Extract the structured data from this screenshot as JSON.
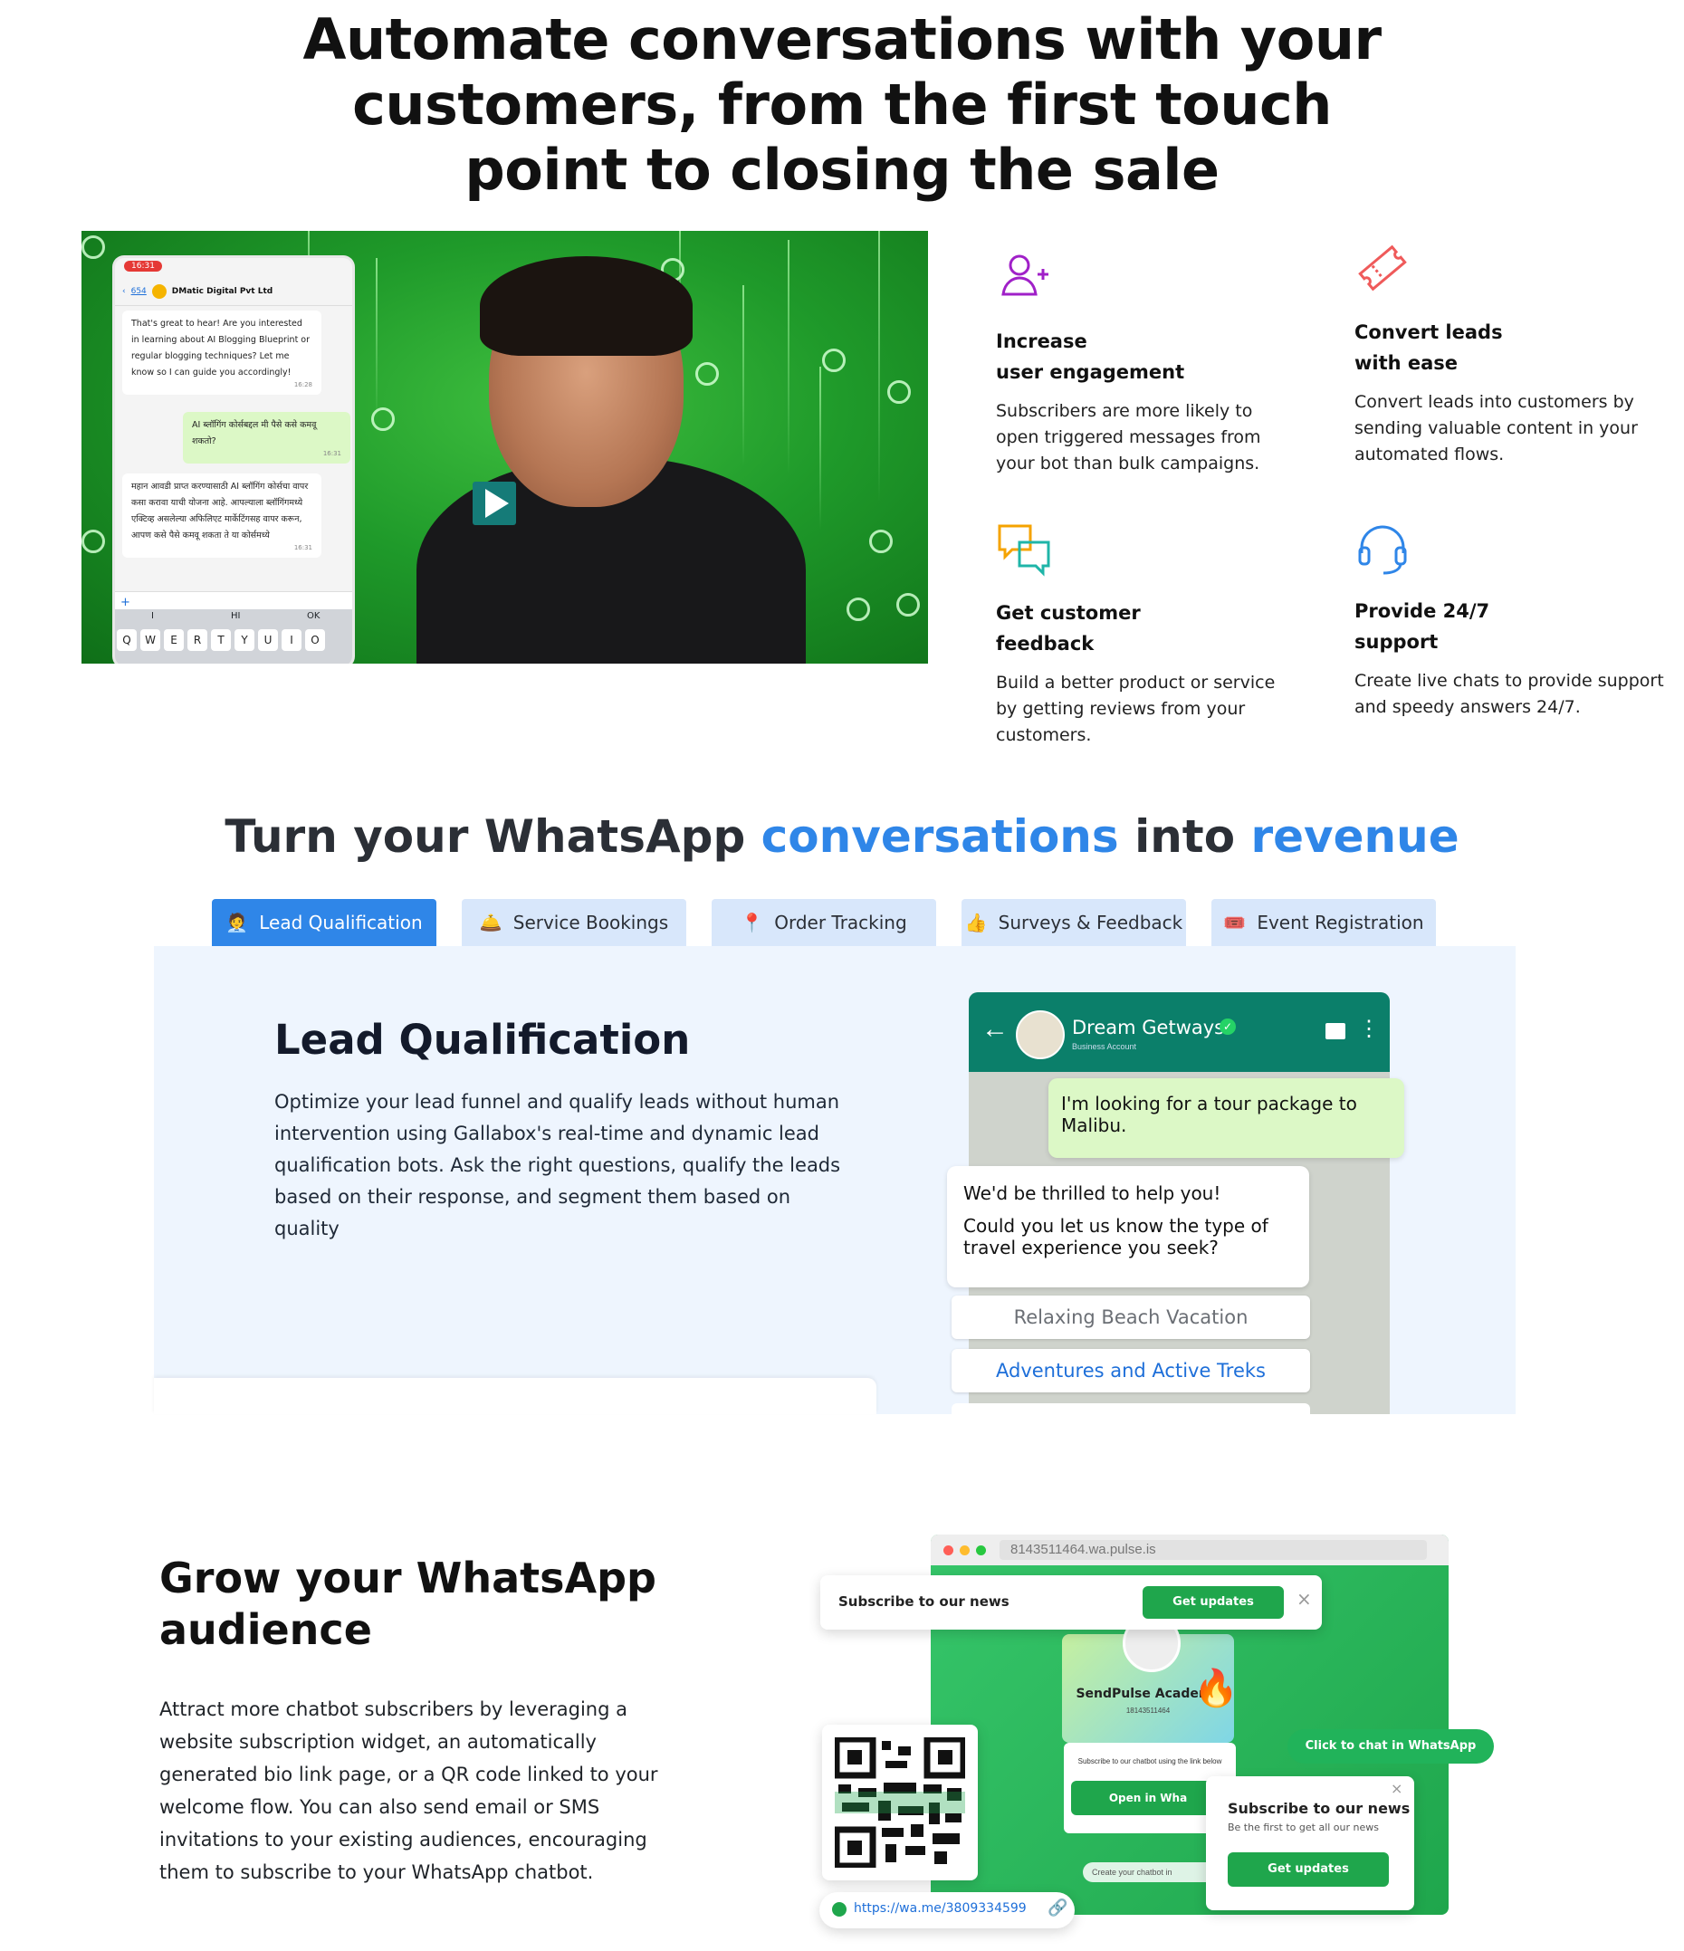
{
  "hero": {
    "title": "Automate conversations with your customers, from the first touch point to closing the sale"
  },
  "video": {
    "phone_time": "16:31",
    "phone_back": "654",
    "phone_contact": "DMatic Digital Pvt Ltd",
    "msg1": "That's great to hear! Are you interested in learning about AI Blogging Blueprint or regular blogging techniques? Let me know so I can guide you accordingly!",
    "msg1_time": "16:28",
    "msg2": "AI ब्लॉगिंग कोर्सबद्दल मी पैसे कसे कमवू शकतो?",
    "msg2_time": "16:31",
    "msg3": "महान आवडी प्राप्त करण्यासाठी AI ब्लॉगिंग कोर्सचा वापर कसा करावा याची योजना आहे. आपल्याला ब्लॉगिंगमध्ये एक्टिव्ह असलेल्या अफिलिएट मार्केटिंगसह वापर करून, आपण कसे पैसे कमवू शकता ते या कोर्समध्ये",
    "msg3_time": "16:31",
    "keyboard_suggestions": [
      "I",
      "HI",
      "OK"
    ],
    "keyboard_row": [
      "Q",
      "W",
      "E",
      "R",
      "T",
      "Y",
      "U",
      "I",
      "O"
    ]
  },
  "features": [
    {
      "icon": "user-plus-icon",
      "title_line1": "Increase",
      "title_line2": "user engagement",
      "desc": "Subscribers are more likely to open triggered messages from your bot than bulk campaigns."
    },
    {
      "icon": "ticket-icon",
      "title_line1": "Convert leads",
      "title_line2": "with ease",
      "desc": "Convert leads into customers by sending valuable content in your automated flows."
    },
    {
      "icon": "chat-bubbles-icon",
      "title_line1": "Get customer",
      "title_line2": "feedback",
      "desc": "Build a better product or service by getting reviews from your customers."
    },
    {
      "icon": "headset-icon",
      "title_line1": "Provide 24/7",
      "title_line2": "support",
      "desc": "Create live chats to provide support and speedy answers 24/7."
    }
  ],
  "revenue": {
    "title_part1": "Turn your WhatsApp ",
    "title_hl1": "conversations",
    "title_part2": " into ",
    "title_hl2": "revenue",
    "accent_color": "#2f86e8",
    "tabs": [
      {
        "icon": "🧑‍💼",
        "label": "Lead Qualification"
      },
      {
        "icon": "🛎️",
        "label": "Service Bookings"
      },
      {
        "icon": "📍",
        "label": "Order Tracking"
      },
      {
        "icon": "👍",
        "label": "Surveys & Feedback"
      },
      {
        "icon": "🎟️",
        "label": "Event Registration"
      }
    ],
    "panel_title": "Lead Qualification",
    "panel_desc": "Optimize your lead funnel and qualify leads without human intervention using Gallabox's real-time and dynamic lead qualification bots. Ask the right questions, qualify the leads based on their response, and segment them based on quality"
  },
  "whatsapp_mock": {
    "business_name": "Dream Getways",
    "business_sub": "Business Account",
    "user_msg": "I'm looking for a tour package to Malibu.",
    "bot_msg_line1": "We'd be thrilled to help you!",
    "bot_msg_line2": "Could you let us know the type of travel experience you seek?",
    "option1": "Relaxing Beach Vacation",
    "option2": "Adventures and Active Treks"
  },
  "grow": {
    "title": "Grow your WhatsApp audience",
    "desc": "Attract more chatbot subscribers by leveraging a website subscription widget, an automatically generated bio link page, or a QR code linked to your welcome flow. You can also send email or SMS invitations to your existing audiences, encouraging them to subscribe to your WhatsApp chatbot.",
    "browser_url": "8143511464.wa.pulse.is",
    "popup_text": "Subscribe to our news",
    "popup_btn": "Get updates",
    "academy_name": "SendPulse Academy",
    "academy_number": "18143511464",
    "subscribe_hint": "Subscribe to our chatbot using the link below",
    "open_btn": "Open in Wha",
    "create_chatbot": "Create your chatbot in",
    "chat_btn": "Click to chat in WhatsApp",
    "card_title": "Subscribe to our news",
    "card_sub": "Be the first to get all our news",
    "card_btn": "Get updates",
    "link_url": "https://wa.me/3809334599"
  }
}
